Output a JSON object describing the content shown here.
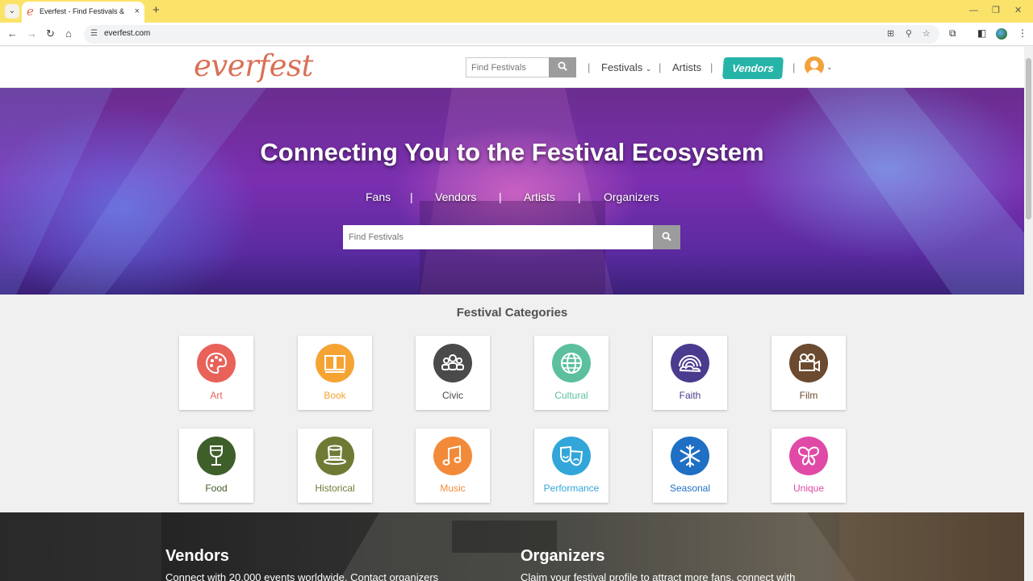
{
  "browser": {
    "tab_title": "Everfest - Find Festivals & Fairs",
    "url": "everfest.com",
    "new_tab": "+",
    "tab_close": "×"
  },
  "header": {
    "logo": "everfest",
    "search_placeholder": "Find Festivals",
    "nav": {
      "festivals": "Festivals",
      "artists": "Artists",
      "vendors": "Vendors"
    },
    "separator": "|",
    "colors": {
      "accent": "#27b4a8",
      "logo": "#d97155",
      "avatar": "#f3a13a"
    }
  },
  "hero": {
    "title": "Connecting You to the Festival Ecosystem",
    "links": [
      "Fans",
      "Vendors",
      "Artists",
      "Organizers"
    ],
    "separator": "|",
    "search_placeholder": "Find Festivals"
  },
  "categories": {
    "title": "Festival Categories",
    "items": [
      {
        "label": "Art",
        "color": "#e8625a",
        "icon": "palette-icon"
      },
      {
        "label": "Book",
        "color": "#f5a434",
        "icon": "book-icon"
      },
      {
        "label": "Civic",
        "color": "#4a4a4a",
        "icon": "people-icon"
      },
      {
        "label": "Cultural",
        "color": "#5cc09f",
        "icon": "globe-icon"
      },
      {
        "label": "Faith",
        "color": "#4b3b8f",
        "icon": "rainbow-icon"
      },
      {
        "label": "Film",
        "color": "#6b4a2f",
        "icon": "film-camera-icon"
      },
      {
        "label": "Food",
        "color": "#3f5f2a",
        "icon": "wine-glass-icon"
      },
      {
        "label": "Historical",
        "color": "#6f7a34",
        "icon": "top-hat-icon"
      },
      {
        "label": "Music",
        "color": "#f28a3a",
        "icon": "music-note-icon"
      },
      {
        "label": "Performance",
        "color": "#33a6d9",
        "icon": "theater-masks-icon"
      },
      {
        "label": "Seasonal",
        "color": "#1f6fc4",
        "icon": "snowflake-icon"
      },
      {
        "label": "Unique",
        "color": "#e04aa6",
        "icon": "butterfly-icon"
      }
    ]
  },
  "bottom": {
    "vendors": {
      "title": "Vendors",
      "text": "Connect with 20,000 events worldwide. Contact organizers"
    },
    "organizers": {
      "title": "Organizers",
      "text": "Claim your festival profile to attract more fans, connect with"
    }
  }
}
